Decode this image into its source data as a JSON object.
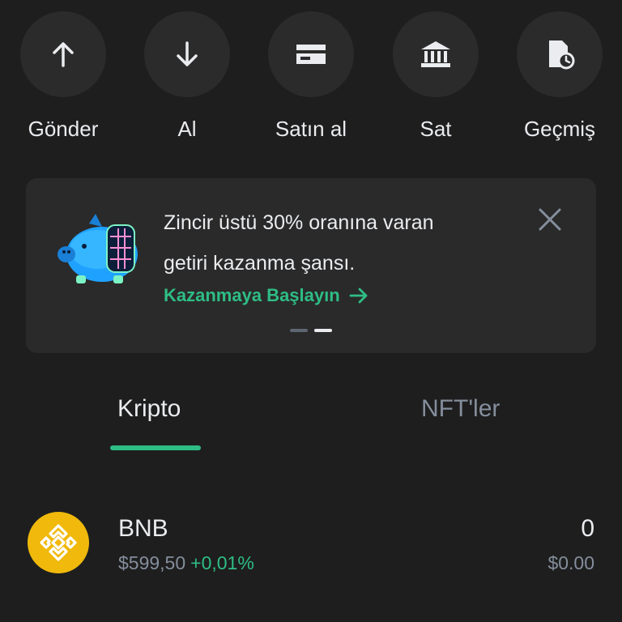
{
  "actions": [
    {
      "label": "Gönder",
      "icon": "arrow-up-icon"
    },
    {
      "label": "Al",
      "icon": "arrow-down-icon"
    },
    {
      "label": "Satın al",
      "icon": "card-icon"
    },
    {
      "label": "Sat",
      "icon": "bank-icon"
    },
    {
      "label": "Geçmiş",
      "icon": "history-icon"
    }
  ],
  "promo": {
    "line1": "Zincir üstü 30% oranına varan",
    "line2": "getiri kazanma şansı.",
    "cta": "Kazanmaya Başlayın",
    "pager": {
      "count": 2,
      "active": 2
    }
  },
  "tabs": [
    {
      "label": "Kripto",
      "active": true
    },
    {
      "label": "NFT'ler",
      "active": false
    }
  ],
  "assets": [
    {
      "name": "BNB",
      "price": "$599,50",
      "change": "+0,01%",
      "amount": "0",
      "value": "$0.00"
    }
  ],
  "colors": {
    "background": "#1e1e1e",
    "card": "#2a2a2a",
    "accent_green": "#2ebd85",
    "bnb_yellow": "#f0b90b",
    "muted_text": "#848e9c"
  }
}
